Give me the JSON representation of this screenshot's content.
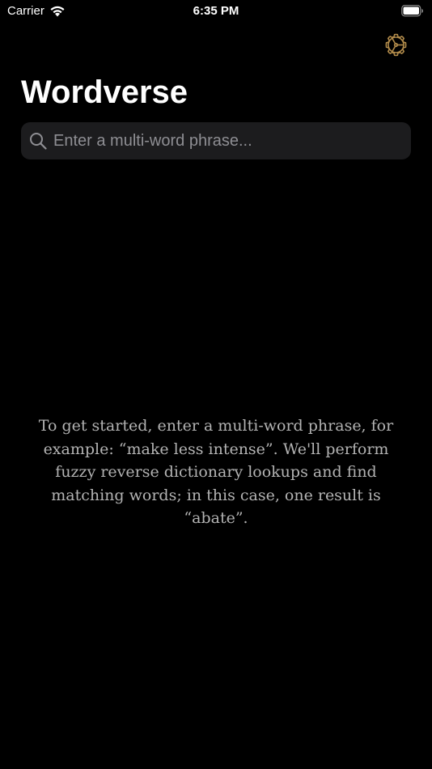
{
  "status_bar": {
    "carrier": "Carrier",
    "time": "6:35 PM",
    "wifi_icon": "wifi-icon",
    "battery_icon": "battery-icon"
  },
  "header": {
    "title": "Wordverse",
    "settings_icon": "settings-gear-icon",
    "settings_color": "#b08a4a"
  },
  "search": {
    "placeholder": "Enter a multi-word phrase...",
    "value": ""
  },
  "empty_state": {
    "text": "To get started, enter a multi-word phrase, for example: “make less intense”. We'll perform fuzzy reverse dictionary lookups and find matching words; in this case, one result is “abate”."
  }
}
